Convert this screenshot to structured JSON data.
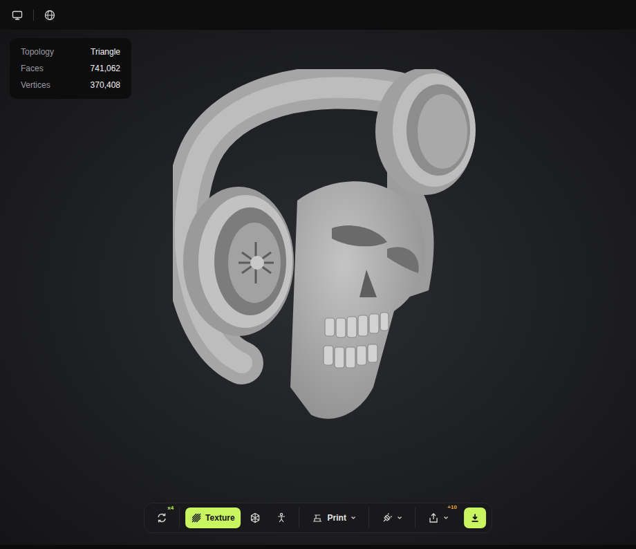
{
  "stats": [
    {
      "label": "Topology",
      "value": "Triangle"
    },
    {
      "label": "Faces",
      "value": "741,062"
    },
    {
      "label": "Vertices",
      "value": "370,408"
    }
  ],
  "toolbar": {
    "rotate": {
      "badge": "x4"
    },
    "texture": {
      "label": "Texture",
      "selected": true
    },
    "print": {
      "label": "Print"
    },
    "share": {
      "badge": "+10"
    }
  }
}
